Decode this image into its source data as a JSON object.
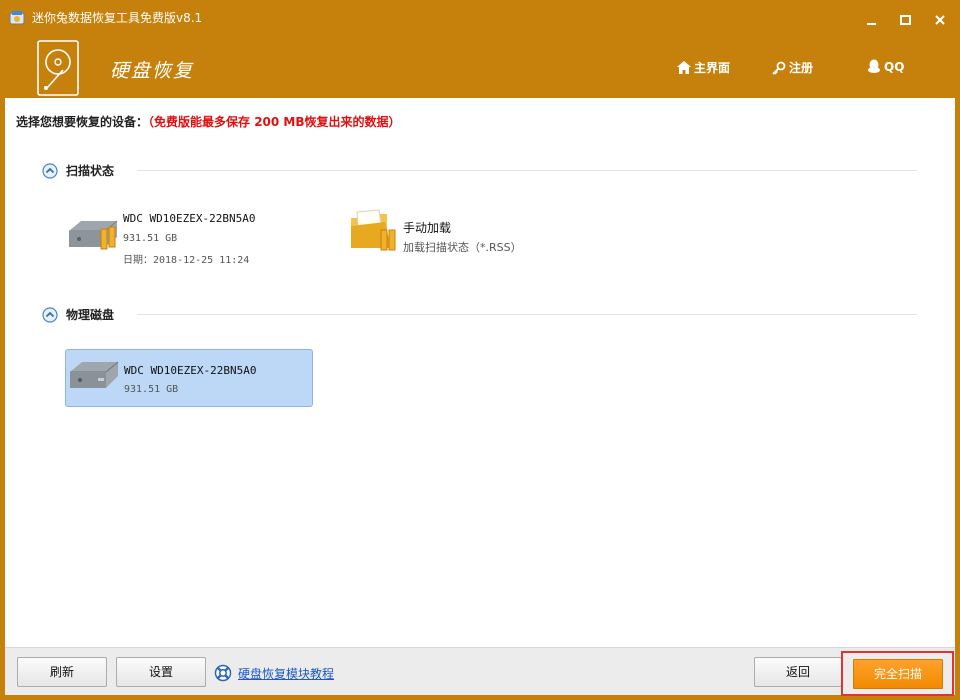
{
  "window": {
    "title": "迷你兔数据恢复工具免费版v8.1",
    "accent_color": "#c6810c"
  },
  "header": {
    "title": "硬盘恢复",
    "nav": {
      "home": {
        "label": "主界面",
        "icon": "home-icon"
      },
      "register": {
        "label": "注册",
        "icon": "key-icon"
      },
      "qq": {
        "label": "QQ",
        "icon": "qq-penguin-icon"
      }
    }
  },
  "main": {
    "prompt": "选择您想要恢复的设备：",
    "prompt_note": "（免费版能最多保存 200 MB恢复出来的数据）",
    "scan_status": {
      "label": "扫描状态",
      "items": [
        {
          "name": "WDC WD10EZEX-22BN5A0",
          "size": "931.51 GB",
          "date": "日期：2018-12-25 11:24",
          "icon": "hard-drive-icon"
        },
        {
          "name": "手动加载",
          "description": "加载扫描状态（*.RSS）",
          "icon": "folder-icon"
        }
      ]
    },
    "physical_disks": {
      "label": "物理磁盘",
      "items": [
        {
          "name": "WDC WD10EZEX-22BN5A0",
          "size": "931.51 GB",
          "selected": true,
          "icon": "hard-drive-icon"
        }
      ]
    }
  },
  "footer": {
    "refresh_label": "刷新",
    "settings_label": "设置",
    "help_link": "硬盘恢复模块教程",
    "back_label": "返回",
    "full_scan_label": "完全扫描",
    "full_scan_color": "#f39200"
  }
}
